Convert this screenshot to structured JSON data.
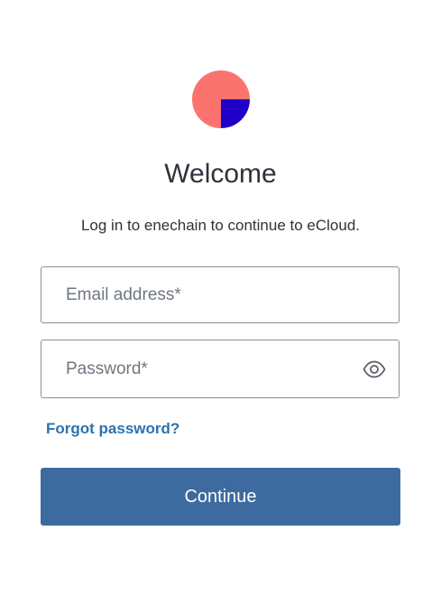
{
  "logo": {
    "name": "enechain-logo",
    "colors": {
      "circle": "#fa736e",
      "quarter": "#2000c8"
    }
  },
  "header": {
    "title": "Welcome",
    "subtitle": "Log in to enechain to continue to eCloud."
  },
  "form": {
    "email": {
      "placeholder": "Email address*",
      "value": ""
    },
    "password": {
      "placeholder": "Password*",
      "value": "",
      "toggle_icon": "eye-icon"
    },
    "forgot_label": "Forgot password?",
    "submit_label": "Continue"
  },
  "colors": {
    "primary": "#3d6b9f",
    "link": "#2a73b0",
    "text": "#2d333a",
    "border": "#8a8f98"
  }
}
